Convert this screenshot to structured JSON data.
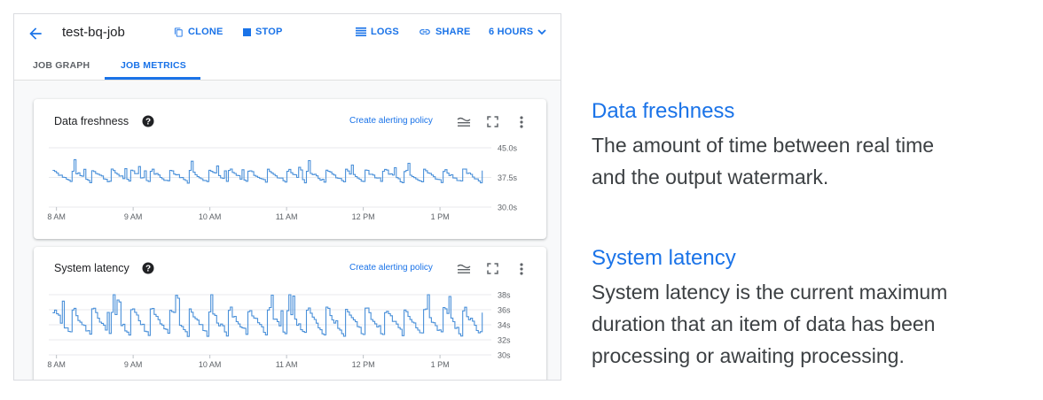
{
  "header": {
    "job_title": "test-bq-job",
    "clone_label": "CLONE",
    "stop_label": "STOP",
    "logs_label": "LOGS",
    "share_label": "SHARE",
    "time_range": "6 HOURS"
  },
  "tabs": [
    {
      "label": "JOB GRAPH",
      "active": false
    },
    {
      "label": "JOB METRICS",
      "active": true
    }
  ],
  "cards": [
    {
      "title": "Data freshness",
      "link": "Create alerting policy",
      "y_ticks": [
        "45.0s",
        "37.5s",
        "30.0s"
      ],
      "x_ticks": [
        "8 AM",
        "9 AM",
        "10 AM",
        "11 AM",
        "12 PM",
        "1 PM"
      ]
    },
    {
      "title": "System latency",
      "link": "Create alerting policy",
      "y_ticks": [
        "38s",
        "36s",
        "34s",
        "32s",
        "30s"
      ],
      "x_ticks": [
        "8 AM",
        "9 AM",
        "10 AM",
        "11 AM",
        "12 PM",
        "1 PM"
      ]
    }
  ],
  "chart_data": [
    {
      "type": "line",
      "title": "Data freshness",
      "unit": "s",
      "x_hours": [
        7.9,
        13.6
      ],
      "ylim": [
        30,
        45
      ],
      "series_color": "#4a90d9",
      "pattern": "sawtooth",
      "baseline": 37.5,
      "amplitude": 2.0,
      "cycles": 22
    },
    {
      "type": "line",
      "title": "System latency",
      "unit": "s",
      "x_hours": [
        7.9,
        13.6
      ],
      "ylim": [
        30,
        38
      ],
      "series_color": "#4a90d9",
      "pattern": "sawtooth",
      "baseline": 34,
      "amplitude": 2.2,
      "cycles": 22
    }
  ],
  "descriptions": [
    {
      "heading": "Data freshness",
      "body": "The amount of time between real time\nand the output watermark."
    },
    {
      "heading": "System latency",
      "body": "System latency is the current maximum\nduration that an item of data has been\nprocessing or awaiting processing."
    }
  ],
  "colors": {
    "accent": "#1a73e8",
    "series": "#4a90d9",
    "text": "#202124",
    "muted": "#5f6368"
  }
}
